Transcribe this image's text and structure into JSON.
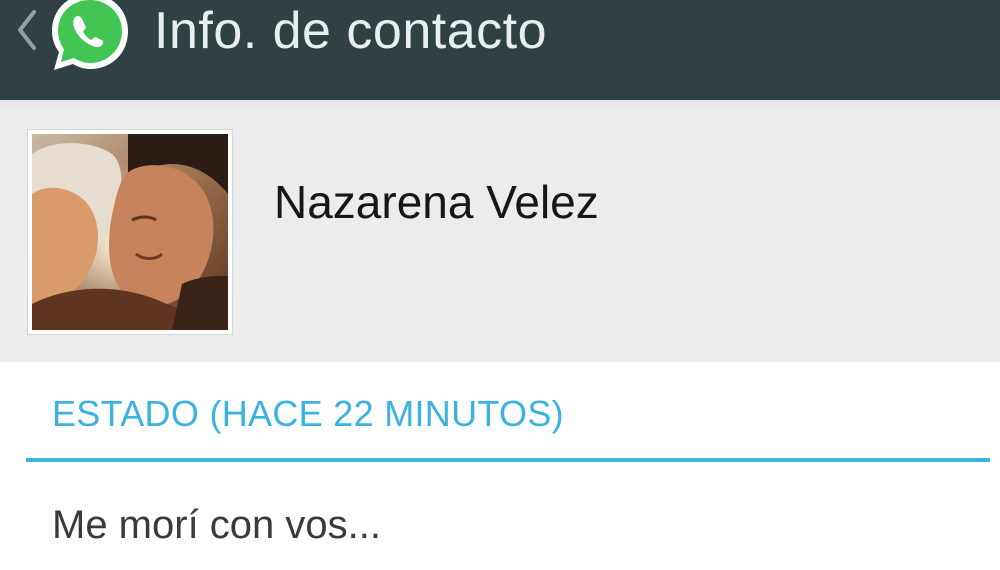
{
  "header": {
    "title": "Info. de contacto",
    "back_icon": "chevron-left-icon",
    "logo_icon": "whatsapp-logo-icon"
  },
  "contact": {
    "name": "Nazarena Velez",
    "avatar_icon": "contact-photo"
  },
  "status": {
    "header": "ESTADO (HACE 22 MINUTOS)",
    "text": "Me morí con vos..."
  },
  "colors": {
    "action_bar": "#2f4143",
    "accent": "#3ab3e0",
    "whatsapp_green": "#43c553",
    "profile_bg": "#ececec"
  }
}
